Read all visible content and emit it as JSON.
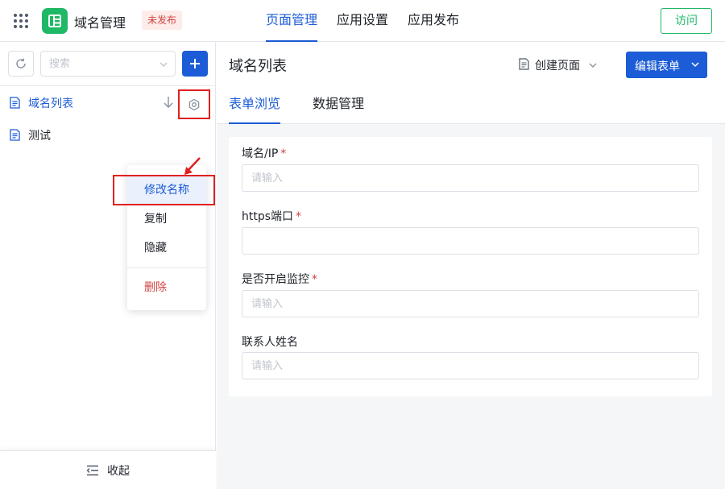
{
  "app": {
    "name": "域名管理",
    "status_badge": "未发布"
  },
  "top_tabs": [
    {
      "label": "页面管理",
      "active": true
    },
    {
      "label": "应用设置",
      "active": false
    },
    {
      "label": "应用发布",
      "active": false
    }
  ],
  "visit_button": "访问",
  "sidebar": {
    "search_placeholder": "搜索",
    "pages": [
      {
        "label": "域名列表",
        "active": true
      },
      {
        "label": "测试",
        "active": false
      }
    ],
    "context_menu": [
      {
        "label": "修改名称",
        "highlighted": true
      },
      {
        "label": "复制"
      },
      {
        "label": "隐藏"
      },
      {
        "label": "删除",
        "danger": true
      }
    ],
    "collapse_label": "收起"
  },
  "main": {
    "page_title": "域名列表",
    "create_page_label": "创建页面",
    "edit_form_label": "编辑表单",
    "subtabs": [
      {
        "label": "表单浏览",
        "active": true
      },
      {
        "label": "数据管理",
        "active": false
      }
    ],
    "form": {
      "fields": [
        {
          "label": "域名/IP",
          "required": true,
          "placeholder": "请输入",
          "value": ""
        },
        {
          "label": "https端口",
          "required": true,
          "placeholder": "",
          "value": ""
        },
        {
          "label": "是否开启监控",
          "required": true,
          "placeholder": "请输入",
          "value": ""
        },
        {
          "label": "联系人姓名",
          "required": false,
          "placeholder": "请输入",
          "value": ""
        }
      ],
      "required_mark": "*"
    }
  },
  "colors": {
    "primary": "#1c5cd6",
    "brand_green": "#1fb866",
    "danger": "#d14343",
    "annotation_red": "#e02020"
  },
  "icons": [
    "app-grid-icon",
    "app-logo-icon",
    "refresh-icon",
    "chevron-down-icon",
    "plus-icon",
    "document-icon",
    "sort-down-icon",
    "gear-icon",
    "collapse-menu-icon"
  ]
}
